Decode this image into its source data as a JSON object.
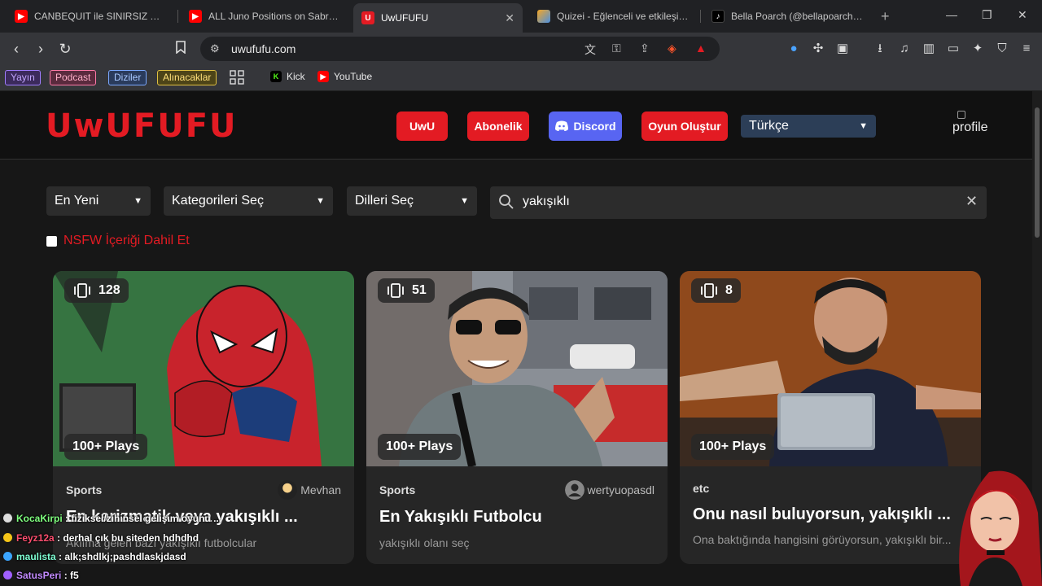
{
  "browser": {
    "tabs": [
      {
        "title": "CANBEQUIT ile SINIRSIZ YEMEK",
        "icon": "youtube-icon",
        "color": "#ff0000"
      },
      {
        "title": "ALL Juno Positions on Sabrina's",
        "icon": "youtube-icon",
        "color": "#ff0000"
      },
      {
        "title": "UwUFUFU",
        "icon": "uwufufu-icon",
        "color": "#e31b23"
      },
      {
        "title": "Quizei - Eğlenceli ve etkileşimli",
        "icon": "quizei-icon",
        "color": "#f5a623"
      },
      {
        "title": "Bella Poarch (@bellapoarch) | T",
        "icon": "tiktok-icon",
        "color": "#000000"
      }
    ],
    "url": "uwufufu.com",
    "bookmarks": {
      "tags": [
        {
          "label": "Yayın",
          "color": "#a07cff"
        },
        {
          "label": "Podcast",
          "color": "#ff7aa8"
        },
        {
          "label": "Diziler",
          "color": "#7aa8ff"
        },
        {
          "label": "Alınacaklar",
          "color": "#e0c040"
        }
      ],
      "links": [
        {
          "label": "Kick",
          "color": "#53fc18"
        },
        {
          "label": "YouTube",
          "color": "#ff0000"
        }
      ]
    }
  },
  "site": {
    "logo": "UwUFUFU",
    "nav": {
      "uwu": "UwU",
      "subscription": "Abonelik",
      "discord": "Discord",
      "create": "Oyun Oluştur",
      "language": "Türkçe",
      "profile_alt": "profile"
    },
    "filters": {
      "sort": "En Yeni",
      "category": "Kategorileri Seç",
      "language": "Dilleri Seç",
      "search_value": "yakışıklı",
      "nsfw_label": "NSFW İçeriği Dahil Et"
    },
    "accent": "#e31b23",
    "cards": [
      {
        "count": "128",
        "plays": "100+ Plays",
        "category": "Sports",
        "author": "Mevhan",
        "title": "En karizmatik veya yakışıklı ...",
        "desc": "Aklıma gelen bazı yakışıklı futbolcular"
      },
      {
        "count": "51",
        "plays": "100+ Plays",
        "category": "Sports",
        "author": "wertyuopasdl",
        "title": "En Yakışıklı Futbolcu",
        "desc": "yakışıklı olanı seç"
      },
      {
        "count": "8",
        "plays": "100+ Plays",
        "category": "etc",
        "author": "",
        "title": "Onu nasıl buluyorsun, yakışıklı ...",
        "desc": "Ona baktığında hangisini görüyorsun, yakışıklı bir..."
      }
    ]
  },
  "chat": [
    {
      "user": "KocaKirpi",
      "user_color": "#7fff7f",
      "message": "fiziksel/zihinsel gelişim oyunu ..."
    },
    {
      "user": "Feyz12a",
      "user_color": "#ff4f6f",
      "message": "derhal çık bu siteden hdhdhd"
    },
    {
      "user": "maulista",
      "user_color": "#7fffd4",
      "message": "alk;shdlkj;pashdlaskjdasd"
    },
    {
      "user": "SatusPeri",
      "user_color": "#c38bff",
      "message": "f5"
    }
  ]
}
